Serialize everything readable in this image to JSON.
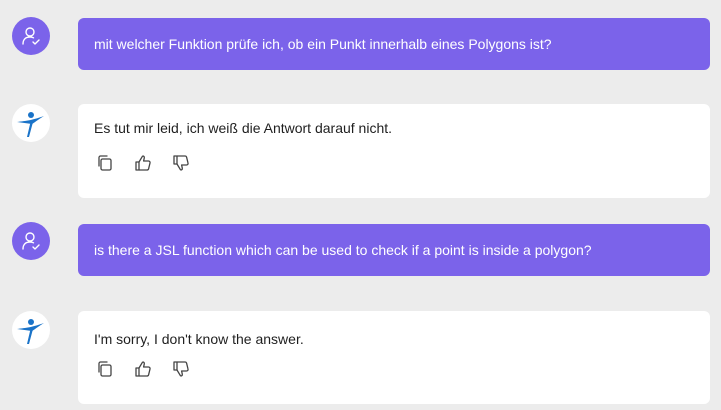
{
  "colors": {
    "user_bubble": "#7b63ea",
    "bot_bubble": "#ffffff",
    "background": "#ececec"
  },
  "messages": [
    {
      "role": "user",
      "avatar_icon": "user-check-icon",
      "text": "mit welcher Funktion prüfe ich, ob ein Punkt innerhalb eines Polygons ist?"
    },
    {
      "role": "assistant",
      "avatar_icon": "bot-logo-icon",
      "text": "Es tut mir leid, ich weiß die Antwort darauf nicht.",
      "actions": [
        "copy-icon",
        "thumbs-up-icon",
        "thumbs-down-icon"
      ]
    },
    {
      "role": "user",
      "avatar_icon": "user-check-icon",
      "text": "is there a JSL function which can be used to check if a point is inside a polygon?"
    },
    {
      "role": "assistant",
      "avatar_icon": "bot-logo-icon",
      "text": "I'm sorry, I don't know the answer.",
      "actions": [
        "copy-icon",
        "thumbs-up-icon",
        "thumbs-down-icon"
      ]
    }
  ]
}
